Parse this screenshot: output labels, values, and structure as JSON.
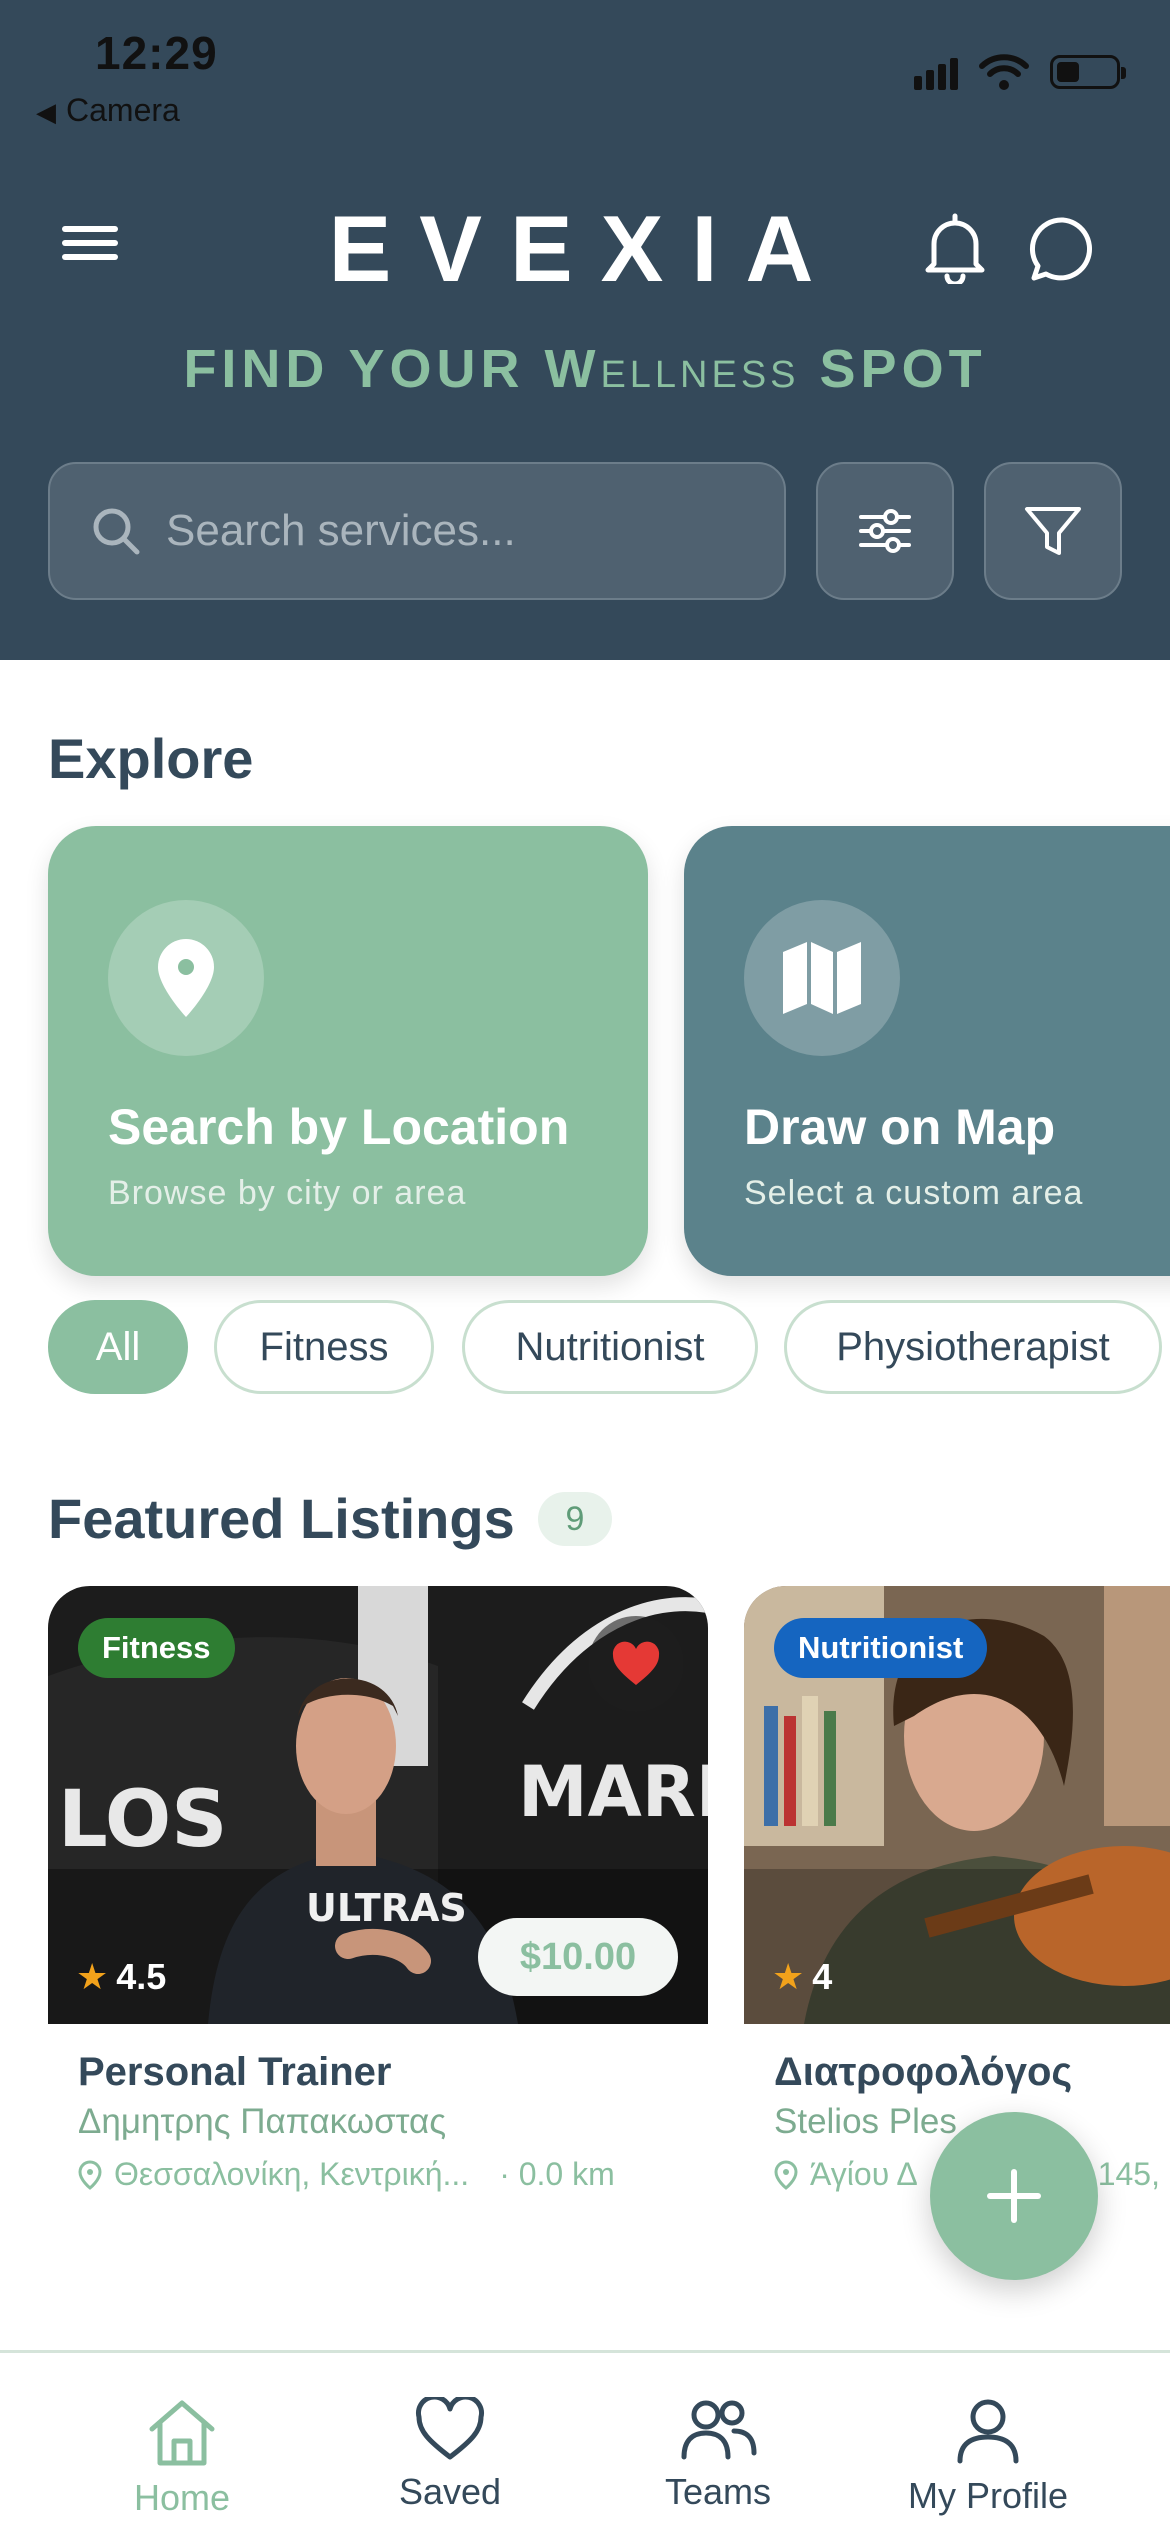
{
  "status_bar": {
    "time": "12:29",
    "back_label": "Camera"
  },
  "header": {
    "logo": "EVEXIA",
    "tagline": {
      "part1": "FIND YOUR W",
      "part2": "ELLNESS",
      "part3": " SPOT"
    },
    "search_placeholder": "Search services..."
  },
  "explore": {
    "title": "Explore",
    "cards": [
      {
        "title": "Search by Location",
        "subtitle": "Browse by city or area",
        "icon": "map-pin-icon",
        "color": "#8bbfa0"
      },
      {
        "title": "Draw on Map",
        "subtitle": "Select a custom area",
        "icon": "map-icon",
        "color": "#5b828b"
      }
    ]
  },
  "filters": [
    "All",
    "Fitness",
    "Nutritionist",
    "Physiotherapist"
  ],
  "featured": {
    "title": "Featured Listings",
    "count": "9",
    "listings": [
      {
        "category": "Fitness",
        "category_color": "#2e7d32",
        "rating": "4.5",
        "price": "$10.00",
        "title": "Personal Trainer",
        "provider": "Δημητρης Παπακωστας",
        "location": "Θεσσαλονίκη, Κεντρική...",
        "distance": "· 0.0 km",
        "favorited": true
      },
      {
        "category": "Nutritionist",
        "category_color": "#1565c0",
        "rating": "4",
        "title": "Διατροφολόγος",
        "provider": "Stelios Ples",
        "location": "Άγίου Δ",
        "location_tail": "145,"
      }
    ]
  },
  "tabs": [
    {
      "label": "Home",
      "icon": "home-icon",
      "active": true
    },
    {
      "label": "Saved",
      "icon": "heart-icon"
    },
    {
      "label": "Teams",
      "icon": "users-icon"
    },
    {
      "label": "My Profile",
      "icon": "user-icon"
    }
  ]
}
